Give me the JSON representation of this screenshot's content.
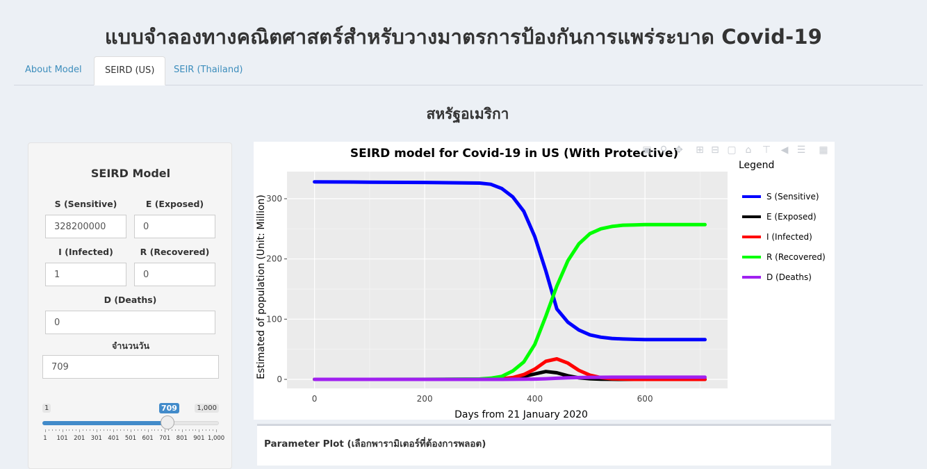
{
  "app": {
    "title": "แบบจำลองทางคณิตศาสตร์สำหรับวางมาตรการป้องกันการแพร่ระบาด Covid-19"
  },
  "tabs": [
    {
      "label": "About Model",
      "active": false
    },
    {
      "label": "SEIRD (US)",
      "active": true
    },
    {
      "label": "SEIR (Thailand)",
      "active": false
    }
  ],
  "section": {
    "title": "สหรัฐอเมริกา"
  },
  "sidebar": {
    "heading": "SEIRD Model",
    "fields": {
      "s": {
        "label": "S (Sensitive)",
        "value": "328200000"
      },
      "e": {
        "label": "E (Exposed)",
        "value": "0"
      },
      "i": {
        "label": "I (Infected)",
        "value": "1"
      },
      "r": {
        "label": "R (Recovered)",
        "value": "0"
      },
      "d": {
        "label": "D (Deaths)",
        "value": "0"
      },
      "days": {
        "label": "จำนวนวัน",
        "value": "709"
      }
    },
    "slider": {
      "min_label": "1",
      "max_label": "1,000",
      "value_label": "709",
      "value": 709,
      "min": 1,
      "max": 1000,
      "tick_labels": [
        "1",
        "101",
        "201",
        "301",
        "401",
        "501",
        "601",
        "701",
        "801",
        "901",
        "1,000"
      ]
    }
  },
  "modebar": {
    "icons": [
      "camera-icon",
      "zoom-icon",
      "pan-icon",
      "zoom-in-icon",
      "zoom-out-icon",
      "autoscale-icon",
      "home-icon",
      "spike-lines-icon",
      "hover-closest-icon",
      "hover-compare-icon",
      "plotly-logo-icon"
    ]
  },
  "chart_data": {
    "type": "line",
    "title": "SEIRD model for Covid-19 in US (With Protective)",
    "xlabel": "Days from 21 January 2020",
    "ylabel": "Estimated of population (Unit: Million)",
    "xlim": [
      -50,
      750
    ],
    "ylim": [
      -15,
      345
    ],
    "x_ticks": [
      0,
      200,
      400,
      600
    ],
    "y_ticks": [
      0,
      100,
      200,
      300
    ],
    "grid": true,
    "plot_bg": "#ebebeb",
    "legend_title": "Legend",
    "legend_position": "right",
    "x": [
      0,
      100,
      200,
      300,
      320,
      340,
      360,
      380,
      400,
      420,
      440,
      460,
      480,
      500,
      520,
      540,
      560,
      580,
      600,
      650,
      700,
      709
    ],
    "series": [
      {
        "name": "S (Sensitive)",
        "color": "#0000ff",
        "values": [
          328,
          327.5,
          327,
          326,
          324,
          317,
          303,
          279,
          237,
          180,
          117,
          95,
          82,
          74,
          70,
          68,
          67,
          66.5,
          66,
          66,
          66,
          66
        ]
      },
      {
        "name": "E (Exposed)",
        "color": "#000000",
        "values": [
          0,
          0,
          0,
          0.1,
          0.3,
          0.8,
          2,
          5,
          9,
          13,
          11,
          6,
          2.5,
          1,
          0.3,
          0.1,
          0,
          0,
          0,
          0,
          0,
          0
        ]
      },
      {
        "name": "I (Infected)",
        "color": "#ff0000",
        "values": [
          0,
          0,
          0,
          0.1,
          0.3,
          1,
          3,
          8,
          17,
          30,
          34,
          27,
          15,
          7,
          3,
          1,
          0.5,
          0,
          0,
          0,
          0,
          0
        ]
      },
      {
        "name": "R (Recovered)",
        "color": "#00ff00",
        "values": [
          0,
          0,
          0.1,
          0.7,
          2,
          5,
          14,
          29,
          58,
          105,
          155,
          197,
          225,
          242,
          250,
          254,
          256,
          256.5,
          257,
          257,
          257,
          257
        ]
      },
      {
        "name": "D (Deaths)",
        "color": "#a020f0",
        "values": [
          0,
          0,
          0,
          0,
          0,
          0,
          0.1,
          0.2,
          0.5,
          1,
          1.8,
          2.5,
          3,
          3.3,
          3.5,
          3.6,
          3.6,
          3.6,
          3.6,
          3.6,
          3.6,
          3.6
        ]
      }
    ]
  },
  "parameter_plot": {
    "title": "Parameter Plot (เลือกพารามิเตอร์ที่ต้องการพลอต)"
  }
}
